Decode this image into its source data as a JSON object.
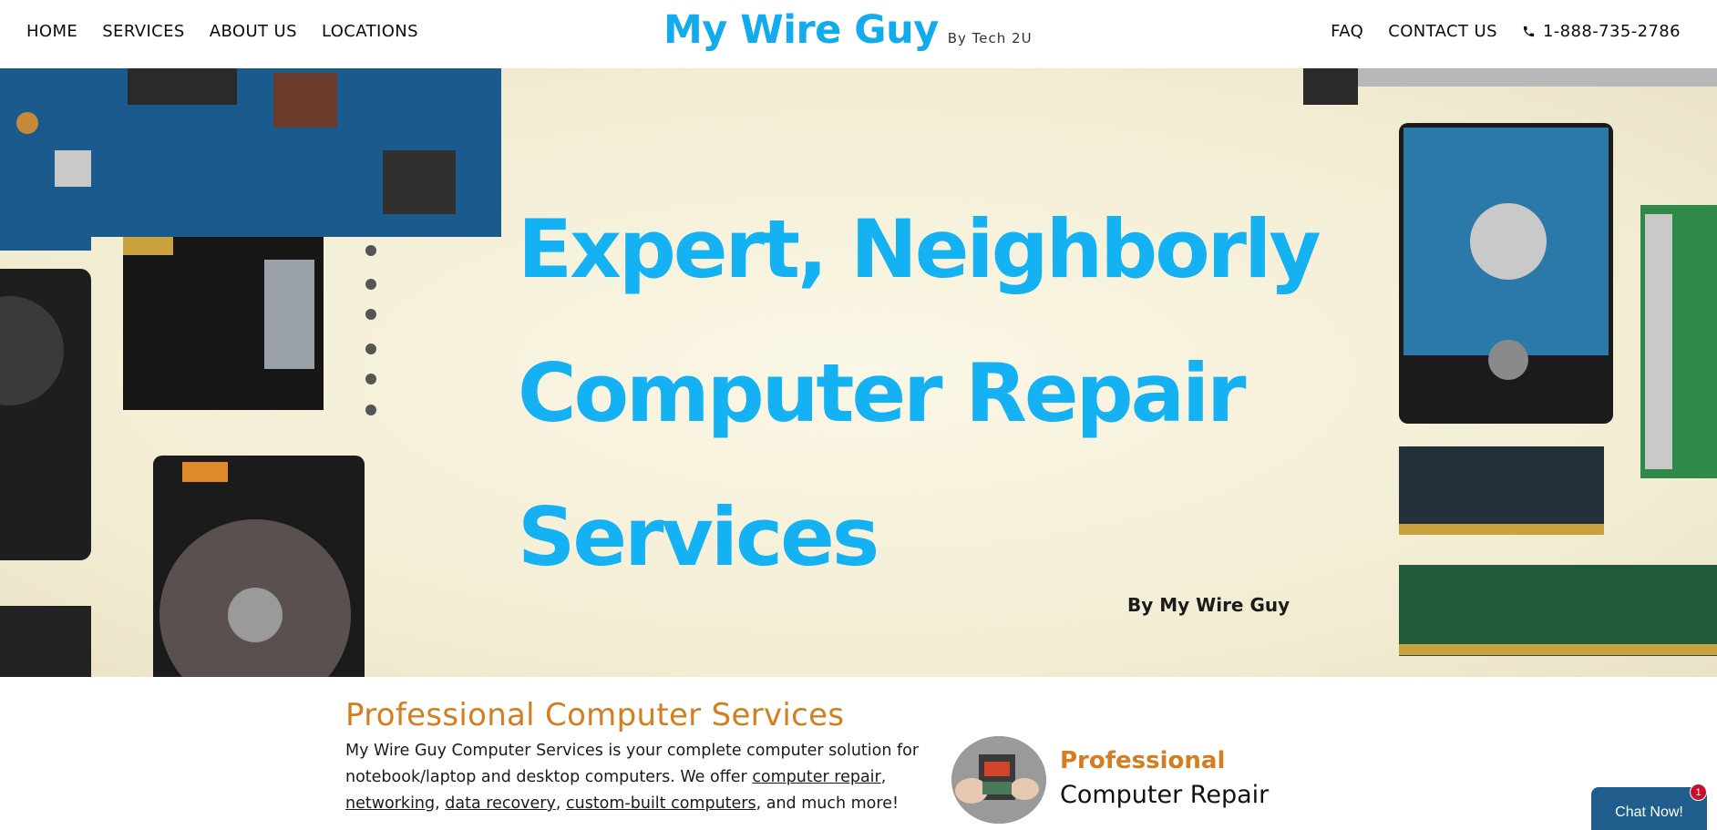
{
  "nav": {
    "left": [
      "HOME",
      "SERVICES",
      "ABOUT US",
      "LOCATIONS"
    ],
    "right": [
      "FAQ",
      "CONTACT US"
    ],
    "phone": "1-888-735-2786",
    "phone_icon": "phone-icon"
  },
  "brand": {
    "title": "My Wire Guy",
    "subtitle": "By Tech 2U"
  },
  "hero": {
    "line1": "Expert, Neighborly",
    "line2": "Computer Repair",
    "line3": "Services",
    "byline": "By My Wire Guy"
  },
  "section": {
    "title": "Professional Computer Services",
    "text_before": "My Wire Guy Computer Services is your complete computer solution for notebook/laptop and desktop computers. We offer ",
    "links": [
      "computer repair",
      "networking",
      "data recovery",
      "custom-built computers"
    ],
    "text_after": ", and much more!"
  },
  "card": {
    "heading": "Professional",
    "subheading": "Computer Repair"
  },
  "chat": {
    "label": "Chat Now!",
    "badge": "1"
  },
  "colors": {
    "brand_blue": "#12abef",
    "accent_orange": "#d57d1f",
    "chat_blue": "#1f5d8d",
    "badge_red": "#c8102e"
  }
}
